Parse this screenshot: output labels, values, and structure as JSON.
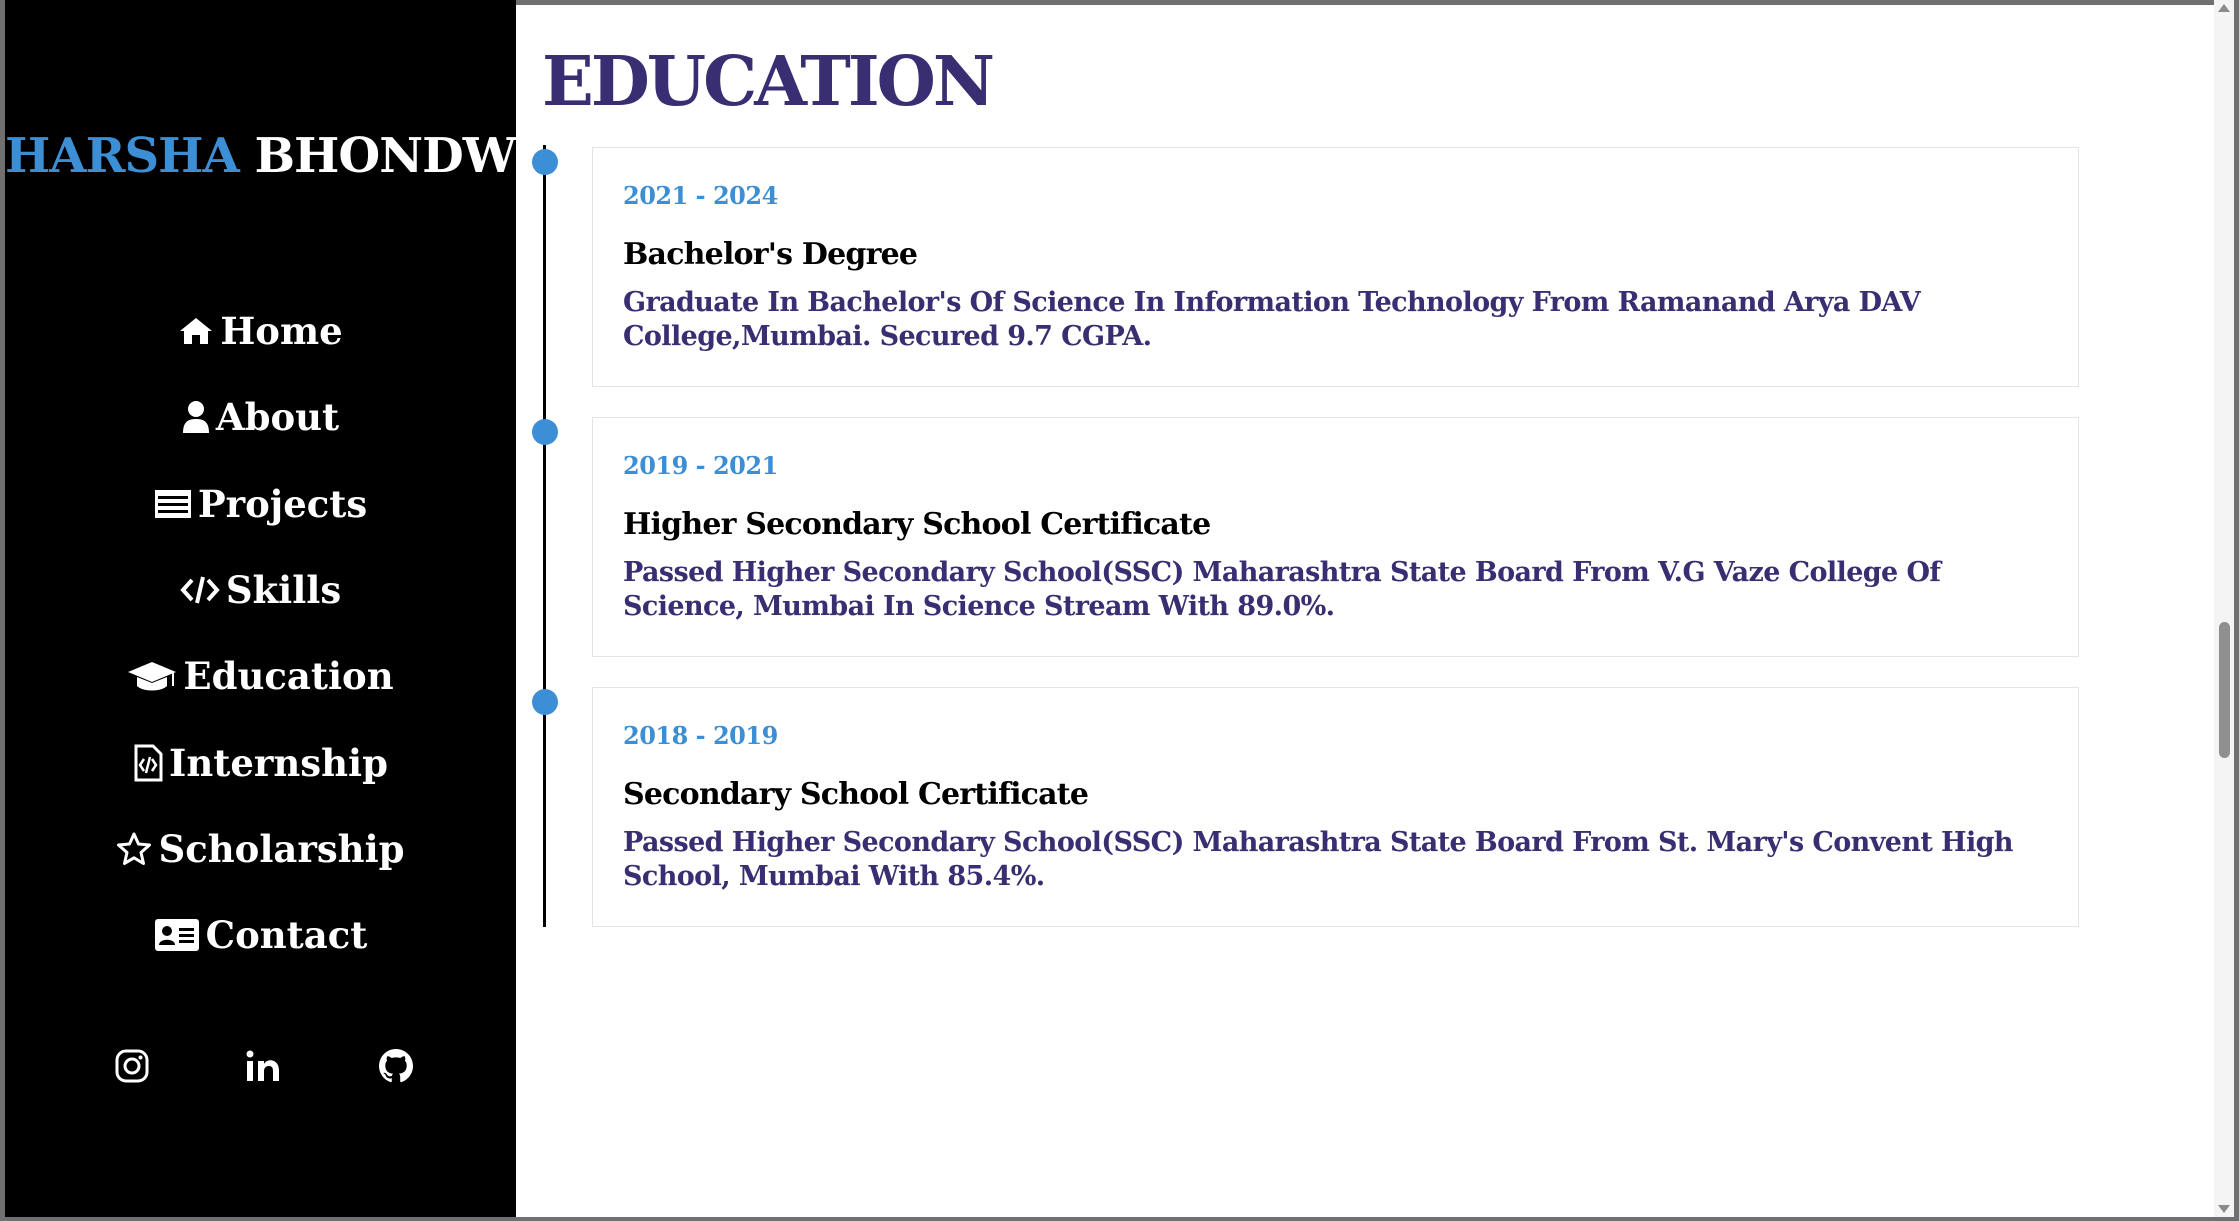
{
  "brand": {
    "first": "HARSHA",
    "last": "BHONDWE"
  },
  "nav": [
    {
      "label": "Home",
      "icon": "home-icon"
    },
    {
      "label": "About",
      "icon": "user-icon"
    },
    {
      "label": "Projects",
      "icon": "list-icon"
    },
    {
      "label": "Skills",
      "icon": "code-icon"
    },
    {
      "label": "Education",
      "icon": "graduation-cap-icon"
    },
    {
      "label": "Internship",
      "icon": "code-file-icon"
    },
    {
      "label": "Scholarship",
      "icon": "star-icon"
    },
    {
      "label": "Contact",
      "icon": "address-card-icon"
    }
  ],
  "social": [
    "instagram-icon",
    "linkedin-icon",
    "github-icon"
  ],
  "page": {
    "title": "EDUCATION"
  },
  "education": [
    {
      "years": "2021 - 2024",
      "degree": "Bachelor's Degree",
      "description": "Graduate In Bachelor's Of Science In Information Technology From Ramanand Arya DAV College,Mumbai. Secured 9.7 CGPA."
    },
    {
      "years": "2019 - 2021",
      "degree": "Higher Secondary School Certificate",
      "description": "Passed Higher Secondary School(SSC) Maharashtra State Board From V.G Vaze College Of Science, Mumbai In Science Stream With 89.0%."
    },
    {
      "years": "2018 - 2019",
      "degree": "Secondary School Certificate",
      "description": "Passed Higher Secondary School(SSC) Maharashtra State Board From St. Mary's Convent High School, Mumbai With 85.4%."
    }
  ],
  "colors": {
    "accent": "#3c8fd4",
    "title": "#3a2e72",
    "sidebar": "#000000"
  }
}
